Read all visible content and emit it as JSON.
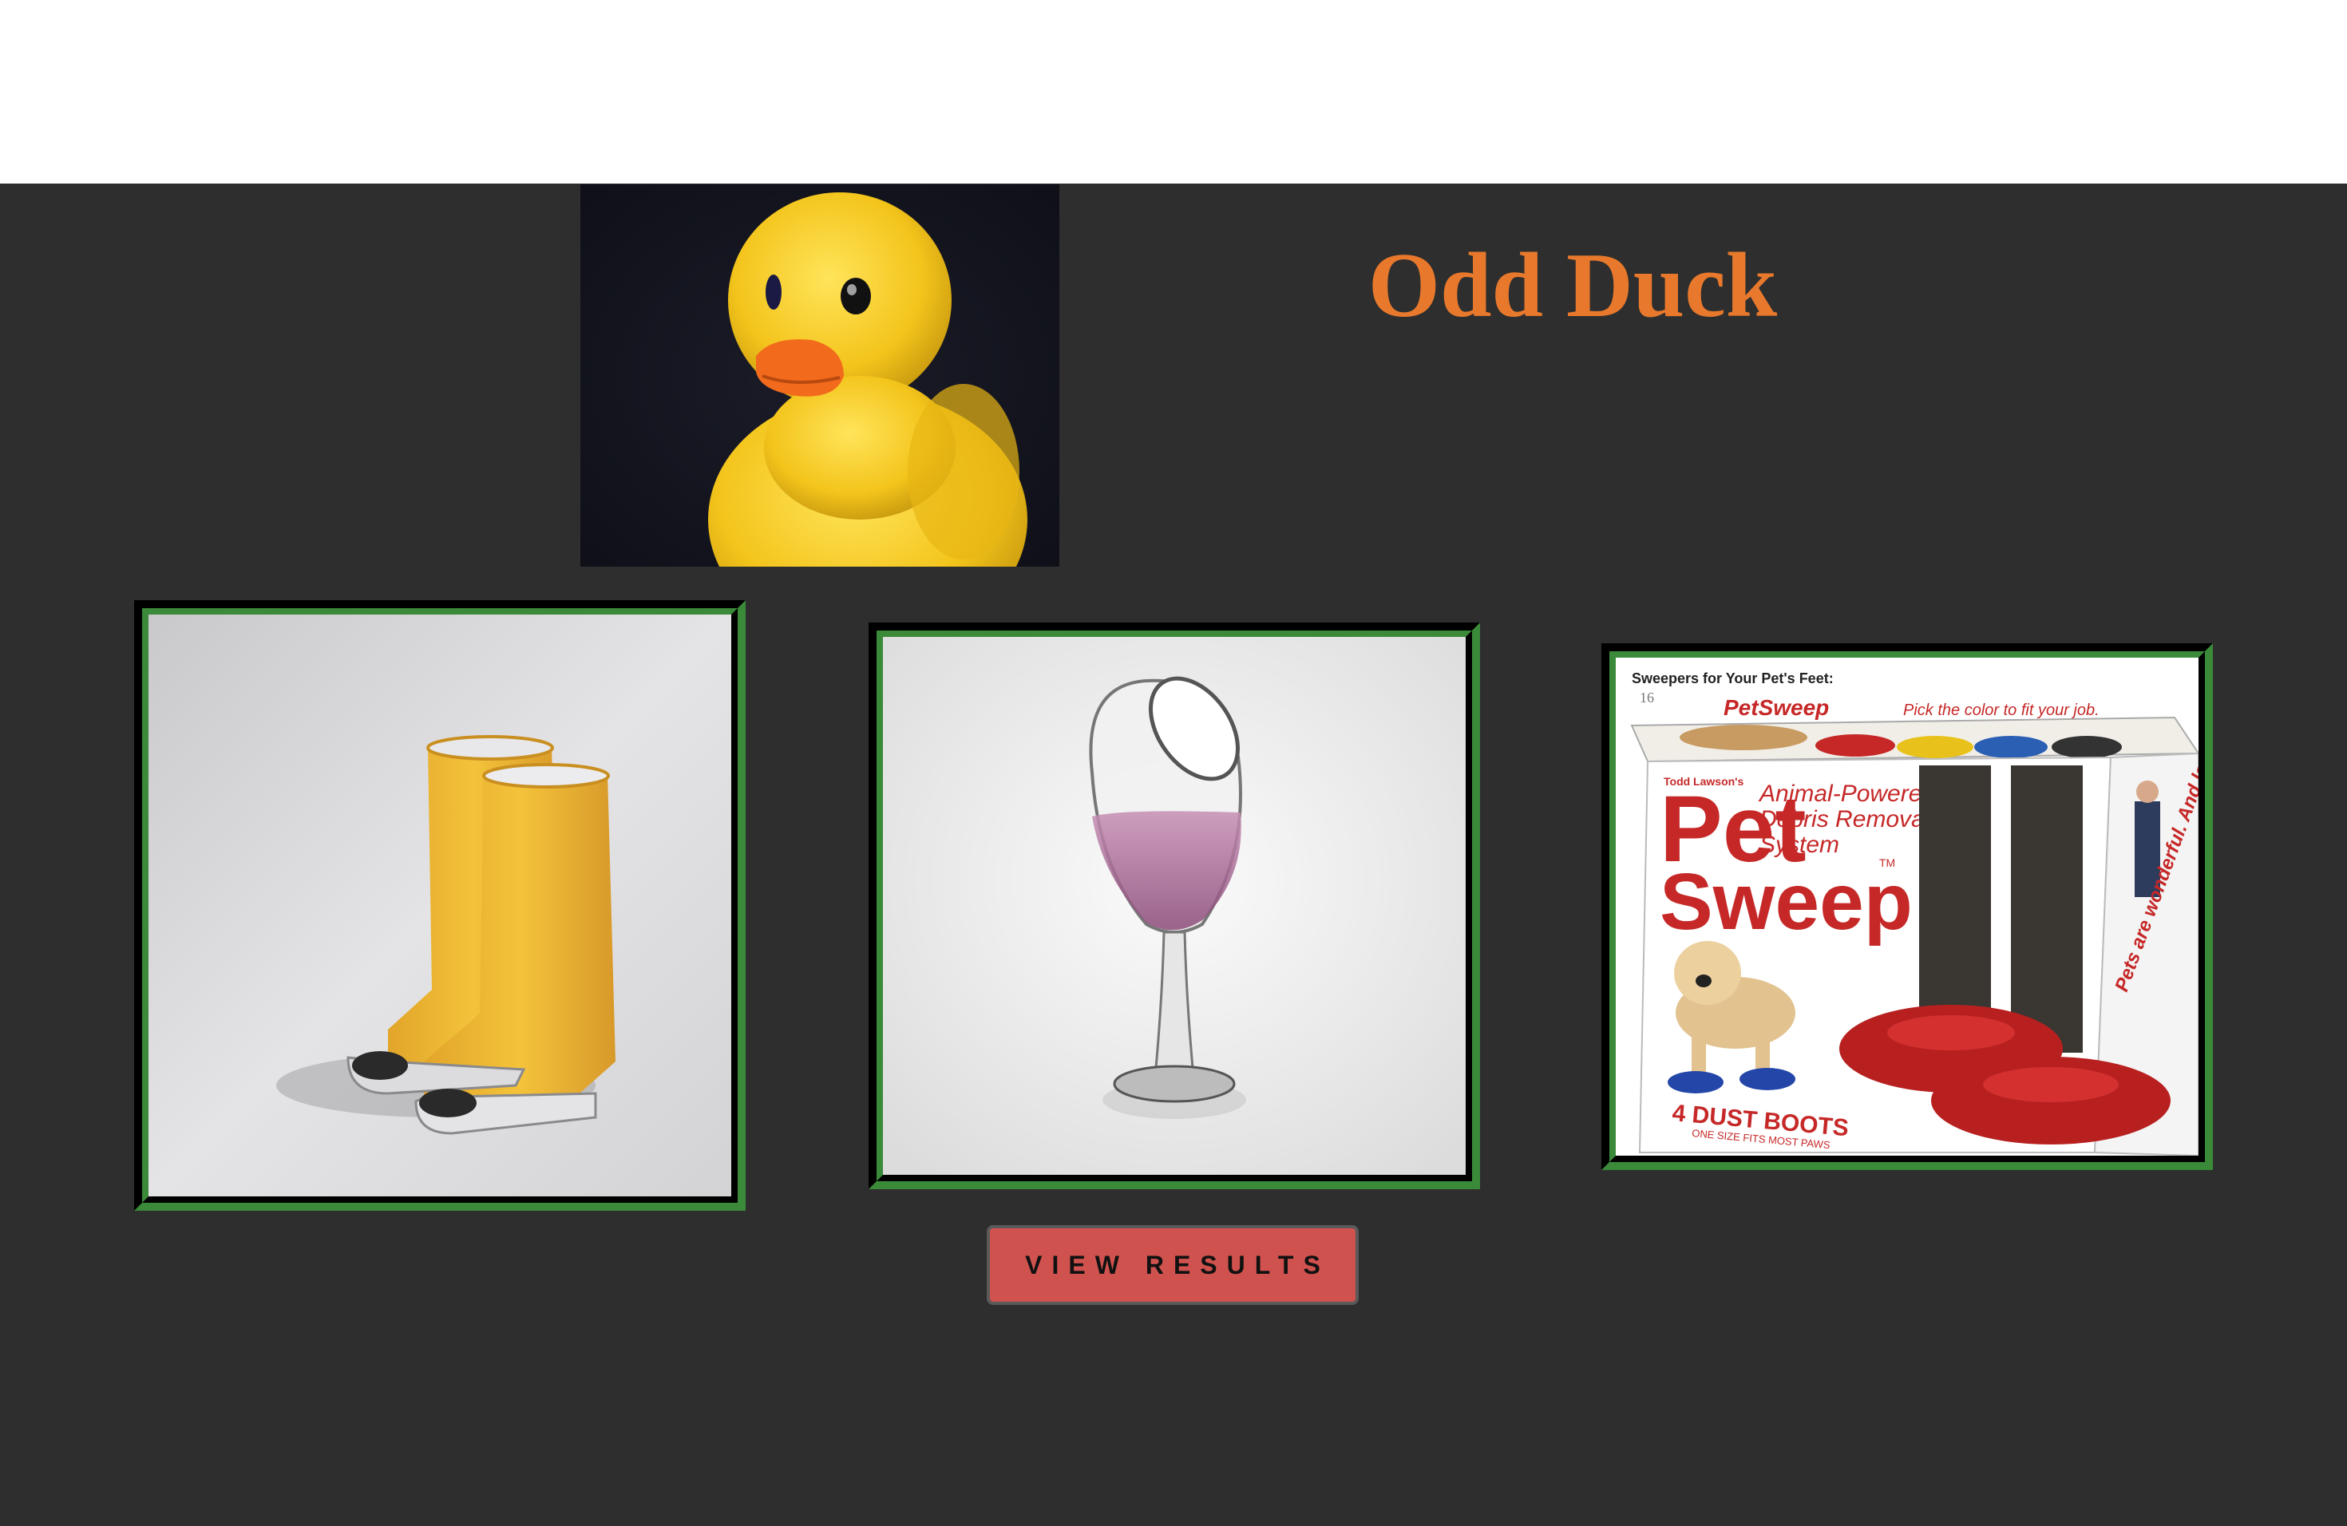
{
  "header": {
    "title": "Odd Duck",
    "logo_icon": "rubber-duck-icon"
  },
  "products": [
    {
      "name": "boots",
      "icon": "rain-boots-icon"
    },
    {
      "name": "wine-glass",
      "icon": "wine-glass-icon"
    },
    {
      "name": "pet-sweep",
      "icon": "pet-sweep-box-icon",
      "box_header": "Sweepers for Your Pet's Feet:",
      "box_number": "16",
      "box_brand_small": "PetSweep",
      "box_tagline": "Pick the color to fit your job.",
      "box_maker": "Todd Lawson's",
      "box_title_1": "Pet",
      "box_title_2": "Sweep",
      "box_tm": "TM",
      "box_desc_1": "Animal-Powered",
      "box_desc_2": "Debris Removal",
      "box_desc_3": "System",
      "box_count": "4 DUST BOOTS",
      "box_size": "ONE SIZE FITS MOST PAWS",
      "box_side": "Pets are wonderful. And lazy."
    }
  ],
  "actions": {
    "results_label": "VIEW RESULTS"
  },
  "colors": {
    "background": "#2e2e2e",
    "title": "#e8792c",
    "frame_green": "#3a8a3a",
    "button": "#d0524e"
  }
}
